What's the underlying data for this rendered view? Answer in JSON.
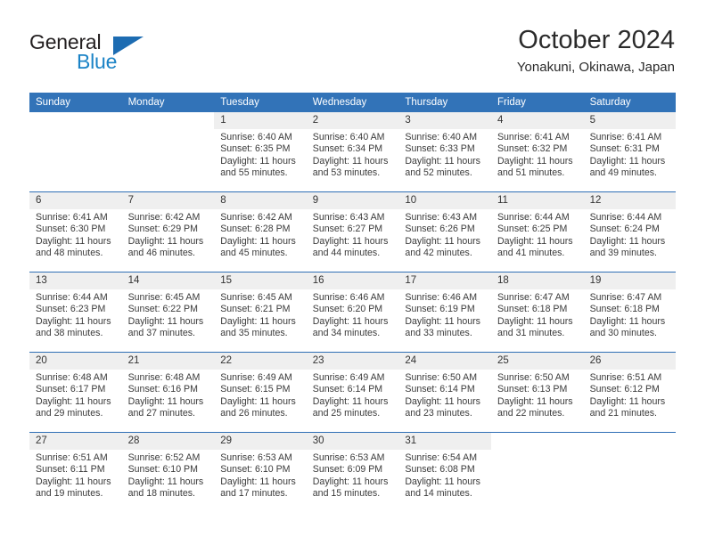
{
  "brand": {
    "name_top": "General",
    "name_bottom": "Blue",
    "triangle_color": "#1d6cb2",
    "blue_color": "#1b83c6"
  },
  "header": {
    "title": "October 2024",
    "subtitle": "Yonakuni, Okinawa, Japan"
  },
  "theme": {
    "header_blue": "#3273b8",
    "separator_blue": "#2f6fb5",
    "daynum_band": "#efefef",
    "text": "#3a3a3a"
  },
  "labels": {
    "sunrise_prefix": "Sunrise:",
    "sunset_prefix": "Sunset:",
    "daylight_prefix": "Daylight:"
  },
  "weekdays": [
    "Sunday",
    "Monday",
    "Tuesday",
    "Wednesday",
    "Thursday",
    "Friday",
    "Saturday"
  ],
  "weeks": [
    [
      {
        "day": "",
        "sunrise": "",
        "sunset": "",
        "daylight": ""
      },
      {
        "day": "",
        "sunrise": "",
        "sunset": "",
        "daylight": ""
      },
      {
        "day": "1",
        "sunrise": "Sunrise: 6:40 AM",
        "sunset": "Sunset: 6:35 PM",
        "daylight": "Daylight: 11 hours and 55 minutes."
      },
      {
        "day": "2",
        "sunrise": "Sunrise: 6:40 AM",
        "sunset": "Sunset: 6:34 PM",
        "daylight": "Daylight: 11 hours and 53 minutes."
      },
      {
        "day": "3",
        "sunrise": "Sunrise: 6:40 AM",
        "sunset": "Sunset: 6:33 PM",
        "daylight": "Daylight: 11 hours and 52 minutes."
      },
      {
        "day": "4",
        "sunrise": "Sunrise: 6:41 AM",
        "sunset": "Sunset: 6:32 PM",
        "daylight": "Daylight: 11 hours and 51 minutes."
      },
      {
        "day": "5",
        "sunrise": "Sunrise: 6:41 AM",
        "sunset": "Sunset: 6:31 PM",
        "daylight": "Daylight: 11 hours and 49 minutes."
      }
    ],
    [
      {
        "day": "6",
        "sunrise": "Sunrise: 6:41 AM",
        "sunset": "Sunset: 6:30 PM",
        "daylight": "Daylight: 11 hours and 48 minutes."
      },
      {
        "day": "7",
        "sunrise": "Sunrise: 6:42 AM",
        "sunset": "Sunset: 6:29 PM",
        "daylight": "Daylight: 11 hours and 46 minutes."
      },
      {
        "day": "8",
        "sunrise": "Sunrise: 6:42 AM",
        "sunset": "Sunset: 6:28 PM",
        "daylight": "Daylight: 11 hours and 45 minutes."
      },
      {
        "day": "9",
        "sunrise": "Sunrise: 6:43 AM",
        "sunset": "Sunset: 6:27 PM",
        "daylight": "Daylight: 11 hours and 44 minutes."
      },
      {
        "day": "10",
        "sunrise": "Sunrise: 6:43 AM",
        "sunset": "Sunset: 6:26 PM",
        "daylight": "Daylight: 11 hours and 42 minutes."
      },
      {
        "day": "11",
        "sunrise": "Sunrise: 6:44 AM",
        "sunset": "Sunset: 6:25 PM",
        "daylight": "Daylight: 11 hours and 41 minutes."
      },
      {
        "day": "12",
        "sunrise": "Sunrise: 6:44 AM",
        "sunset": "Sunset: 6:24 PM",
        "daylight": "Daylight: 11 hours and 39 minutes."
      }
    ],
    [
      {
        "day": "13",
        "sunrise": "Sunrise: 6:44 AM",
        "sunset": "Sunset: 6:23 PM",
        "daylight": "Daylight: 11 hours and 38 minutes."
      },
      {
        "day": "14",
        "sunrise": "Sunrise: 6:45 AM",
        "sunset": "Sunset: 6:22 PM",
        "daylight": "Daylight: 11 hours and 37 minutes."
      },
      {
        "day": "15",
        "sunrise": "Sunrise: 6:45 AM",
        "sunset": "Sunset: 6:21 PM",
        "daylight": "Daylight: 11 hours and 35 minutes."
      },
      {
        "day": "16",
        "sunrise": "Sunrise: 6:46 AM",
        "sunset": "Sunset: 6:20 PM",
        "daylight": "Daylight: 11 hours and 34 minutes."
      },
      {
        "day": "17",
        "sunrise": "Sunrise: 6:46 AM",
        "sunset": "Sunset: 6:19 PM",
        "daylight": "Daylight: 11 hours and 33 minutes."
      },
      {
        "day": "18",
        "sunrise": "Sunrise: 6:47 AM",
        "sunset": "Sunset: 6:18 PM",
        "daylight": "Daylight: 11 hours and 31 minutes."
      },
      {
        "day": "19",
        "sunrise": "Sunrise: 6:47 AM",
        "sunset": "Sunset: 6:18 PM",
        "daylight": "Daylight: 11 hours and 30 minutes."
      }
    ],
    [
      {
        "day": "20",
        "sunrise": "Sunrise: 6:48 AM",
        "sunset": "Sunset: 6:17 PM",
        "daylight": "Daylight: 11 hours and 29 minutes."
      },
      {
        "day": "21",
        "sunrise": "Sunrise: 6:48 AM",
        "sunset": "Sunset: 6:16 PM",
        "daylight": "Daylight: 11 hours and 27 minutes."
      },
      {
        "day": "22",
        "sunrise": "Sunrise: 6:49 AM",
        "sunset": "Sunset: 6:15 PM",
        "daylight": "Daylight: 11 hours and 26 minutes."
      },
      {
        "day": "23",
        "sunrise": "Sunrise: 6:49 AM",
        "sunset": "Sunset: 6:14 PM",
        "daylight": "Daylight: 11 hours and 25 minutes."
      },
      {
        "day": "24",
        "sunrise": "Sunrise: 6:50 AM",
        "sunset": "Sunset: 6:14 PM",
        "daylight": "Daylight: 11 hours and 23 minutes."
      },
      {
        "day": "25",
        "sunrise": "Sunrise: 6:50 AM",
        "sunset": "Sunset: 6:13 PM",
        "daylight": "Daylight: 11 hours and 22 minutes."
      },
      {
        "day": "26",
        "sunrise": "Sunrise: 6:51 AM",
        "sunset": "Sunset: 6:12 PM",
        "daylight": "Daylight: 11 hours and 21 minutes."
      }
    ],
    [
      {
        "day": "27",
        "sunrise": "Sunrise: 6:51 AM",
        "sunset": "Sunset: 6:11 PM",
        "daylight": "Daylight: 11 hours and 19 minutes."
      },
      {
        "day": "28",
        "sunrise": "Sunrise: 6:52 AM",
        "sunset": "Sunset: 6:10 PM",
        "daylight": "Daylight: 11 hours and 18 minutes."
      },
      {
        "day": "29",
        "sunrise": "Sunrise: 6:53 AM",
        "sunset": "Sunset: 6:10 PM",
        "daylight": "Daylight: 11 hours and 17 minutes."
      },
      {
        "day": "30",
        "sunrise": "Sunrise: 6:53 AM",
        "sunset": "Sunset: 6:09 PM",
        "daylight": "Daylight: 11 hours and 15 minutes."
      },
      {
        "day": "31",
        "sunrise": "Sunrise: 6:54 AM",
        "sunset": "Sunset: 6:08 PM",
        "daylight": "Daylight: 11 hours and 14 minutes."
      },
      {
        "day": "",
        "sunrise": "",
        "sunset": "",
        "daylight": ""
      },
      {
        "day": "",
        "sunrise": "",
        "sunset": "",
        "daylight": ""
      }
    ]
  ]
}
